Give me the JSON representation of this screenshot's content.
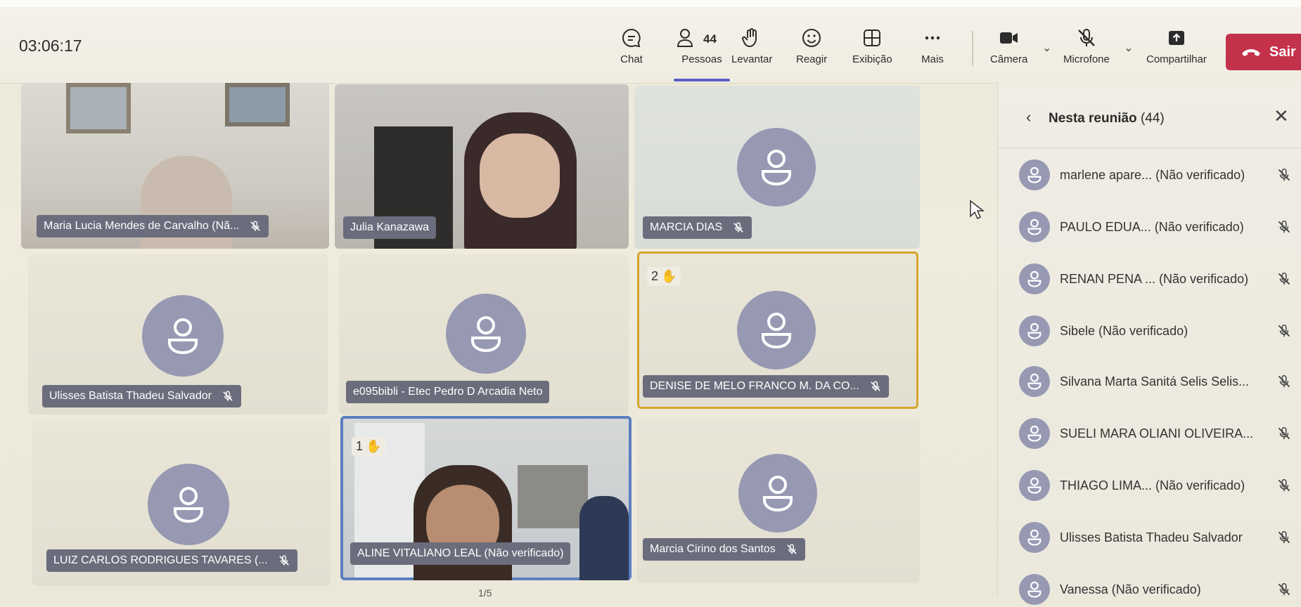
{
  "meeting": {
    "elapsed_time": "03:06:17",
    "people_count": "44",
    "toolbar": {
      "chat": "Chat",
      "people": "Pessoas",
      "raise": "Levantar",
      "react": "Reagir",
      "view": "Exibição",
      "more": "Mais",
      "camera": "Câmera",
      "mic": "Microfone",
      "share": "Compartilhar",
      "leave": "Sair"
    }
  },
  "grid": {
    "tiles": [
      {
        "name": "Maria Lucia Mendes de Carvalho (Nã...",
        "type": "video",
        "muted": true
      },
      {
        "name": "Julia Kanazawa",
        "type": "video",
        "muted": false
      },
      {
        "name": "MARCIA DIAS",
        "type": "avatar",
        "muted": true
      },
      {
        "name": "Ulisses Batista Thadeu Salvador",
        "type": "avatar",
        "muted": true
      },
      {
        "name": "e095bibli - Etec Pedro D Arcadia Neto",
        "type": "avatar",
        "muted": false
      },
      {
        "name": "DENISE DE MELO FRANCO M. DA CO...",
        "type": "avatar",
        "muted": true,
        "hand_order": "2"
      },
      {
        "name": "LUIZ CARLOS RODRIGUES TAVARES (...",
        "type": "avatar",
        "muted": true
      },
      {
        "name": "ALINE VITALIANO LEAL (Não verificado)",
        "type": "video",
        "muted": false,
        "hand_order": "1"
      },
      {
        "name": "Marcia Cirino dos Santos",
        "type": "avatar",
        "muted": true
      }
    ],
    "pager": "1/5"
  },
  "panel": {
    "title": "Nesta reunião",
    "count": "(44)",
    "people": [
      "marlene apare... (Não verificado)",
      "PAULO EDUA...  (Não verificado)",
      "RENAN PENA ... (Não verificado)",
      "Sibele (Não verificado)",
      "Silvana Marta Sanitá Selis Selis...",
      "SUELI MARA OLIANI OLIVEIRA...",
      "THIAGO LIMA... (Não verificado)",
      "Ulisses Batista Thadeu Salvador",
      "Vanessa (Não verificado)"
    ]
  },
  "colors": {
    "accent": "#5b5fc7",
    "leave": "#c4314b",
    "avatar": "#9799b3",
    "raised_hand_border": "#d4a52b",
    "active_speaker_border": "#5a7fbf"
  }
}
